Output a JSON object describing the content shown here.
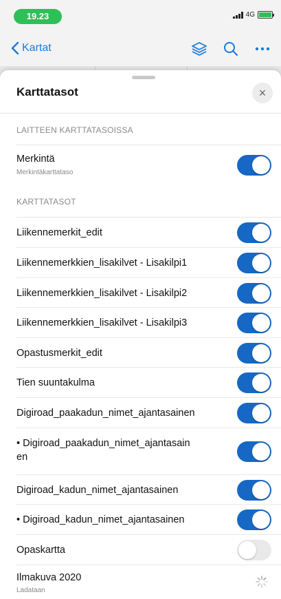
{
  "status_bar": {
    "time": "19.23",
    "network": "4G"
  },
  "nav": {
    "back_label": "Kartat"
  },
  "sheet": {
    "title": "Karttatasot",
    "close_icon": "×",
    "device_section": {
      "header": "LAITTEEN KARTTATASOISSA",
      "items": [
        {
          "label": "Merkintä",
          "sublabel": "Merkintäkarttataso",
          "enabled": true
        }
      ]
    },
    "layers_section": {
      "header": "KARTTATASOT",
      "items": [
        {
          "label": "Liikennemerkit_edit",
          "enabled": true
        },
        {
          "label": "Liikennemerkkien_lisakilvet - Lisakilpi1",
          "enabled": true
        },
        {
          "label": "Liikennemerkkien_lisakilvet - Lisakilpi2",
          "enabled": true
        },
        {
          "label": "Liikennemerkkien_lisakilvet - Lisakilpi3",
          "enabled": true
        },
        {
          "label": "Opastusmerkit_edit",
          "enabled": true
        },
        {
          "label": "Tien suuntakulma",
          "enabled": true
        },
        {
          "label": "Digiroad_paakadun_nimet_ajantasainen",
          "enabled": true
        },
        {
          "label": "• Digiroad_paakadun_nimet_ajantasain\nen",
          "enabled": true
        },
        {
          "label": "Digiroad_kadun_nimet_ajantasainen",
          "enabled": true
        },
        {
          "label": "• Digiroad_kadun_nimet_ajantasainen",
          "enabled": true
        },
        {
          "label": "Opaskartta",
          "enabled": false
        },
        {
          "label": "Ilmakuva 2020",
          "sublabel": "Ladataan",
          "loading": true
        }
      ]
    }
  },
  "colors": {
    "accent": "#1b7ad8",
    "toggle_on": "#1668c4",
    "toggle_off": "#e9e9ea",
    "battery": "#2fbf57"
  }
}
